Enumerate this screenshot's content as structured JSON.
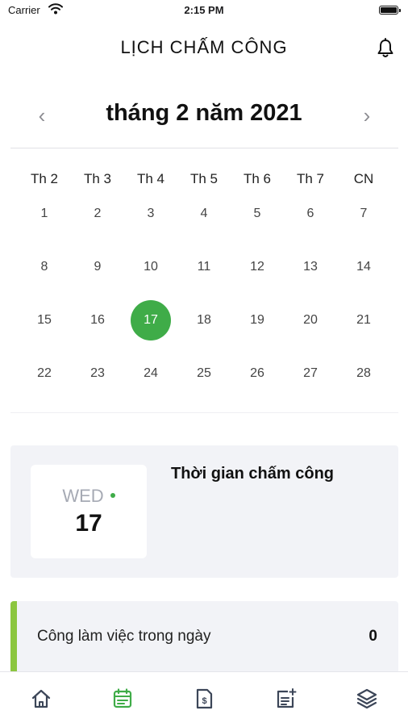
{
  "status_bar": {
    "carrier": "Carrier",
    "time": "2:15 PM",
    "wifi_icon": "wifi-icon",
    "battery_icon": "battery-icon"
  },
  "header": {
    "title": "LỊCH CHẤM CÔNG",
    "bell_icon": "bell-icon"
  },
  "calendar": {
    "month_label": "tháng 2 năm 2021",
    "prev_icon": "‹",
    "next_icon": "›",
    "weekdays": [
      "Th 2",
      "Th 3",
      "Th 4",
      "Th 5",
      "Th 6",
      "Th 7",
      "CN"
    ],
    "weeks": [
      [
        "1",
        "2",
        "3",
        "4",
        "5",
        "6",
        "7"
      ],
      [
        "8",
        "9",
        "10",
        "11",
        "12",
        "13",
        "14"
      ],
      [
        "15",
        "16",
        "17",
        "18",
        "19",
        "20",
        "21"
      ],
      [
        "22",
        "23",
        "24",
        "25",
        "26",
        "27",
        "28"
      ]
    ],
    "selected_day": "17",
    "accent_color": "#3fac48"
  },
  "attendance": {
    "weekday_code": "WED",
    "day": "17",
    "title": "Thời gian chấm công"
  },
  "work": {
    "label": "Công làm việc trong ngày",
    "value": "0",
    "accent_color": "#8cc63f"
  },
  "tab_bar": {
    "tabs": [
      {
        "icon": "home-icon",
        "active": false
      },
      {
        "icon": "calendar-icon",
        "active": true
      },
      {
        "icon": "document-icon",
        "active": false
      },
      {
        "icon": "add-note-icon",
        "active": false
      },
      {
        "icon": "layers-icon",
        "active": false
      }
    ],
    "active_color": "#3fac48",
    "inactive_color": "#3c4658"
  }
}
